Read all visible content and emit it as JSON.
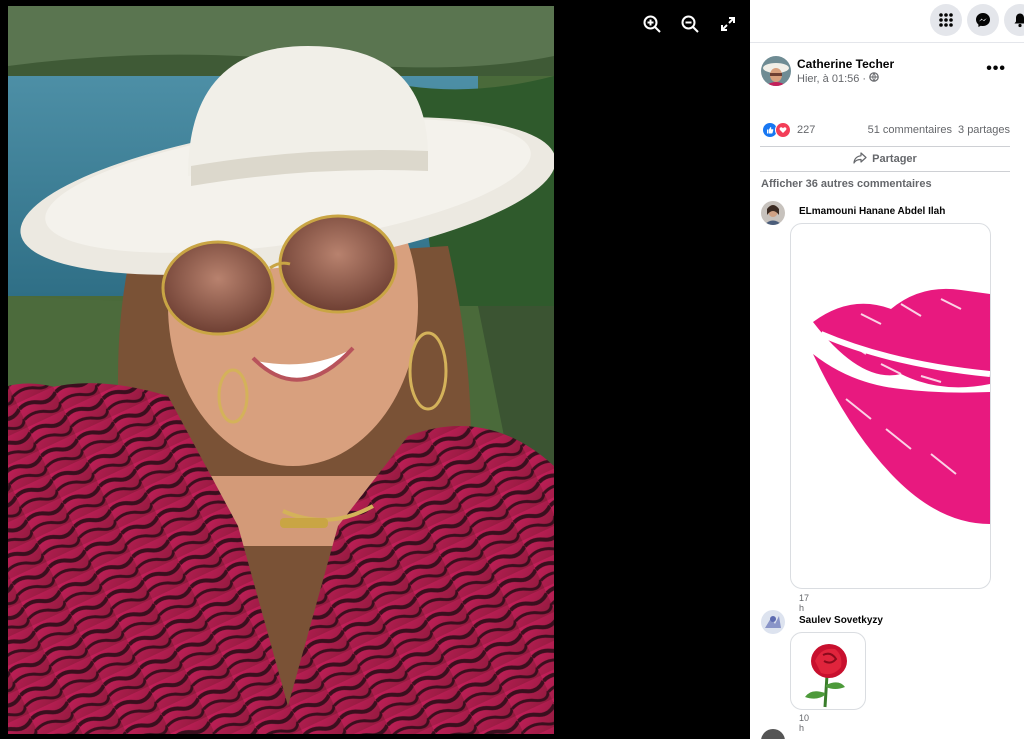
{
  "viewer": {
    "tools": [
      {
        "icon": "zoom-in-icon"
      },
      {
        "icon": "zoom-out-icon"
      },
      {
        "icon": "fullscreen-icon"
      }
    ]
  },
  "topbar": {
    "buttons": [
      {
        "icon": "menu-grid-icon"
      },
      {
        "icon": "messenger-icon"
      },
      {
        "icon": "notifications-bell-icon"
      }
    ]
  },
  "post": {
    "author": "Catherine Techer",
    "time": "Hier, à 01:56 ·",
    "privacy_icon": "globe-icon",
    "reaction_count": "227",
    "comment_count": "51 commentaires",
    "share_count": "3 partages",
    "share_label": "Partager"
  },
  "comments": {
    "more_label": "Afficher 36 autres commentaires",
    "items": [
      {
        "author": "ELmamouni Hanane Abdel Ilah",
        "time": "17 h",
        "media": "lipstick-kiss-sticker"
      },
      {
        "author": "Saulev Sovetkyzy",
        "time": "10 h",
        "media": "red-rose-sticker"
      }
    ]
  },
  "colors": {
    "like_blue": "#1877f2",
    "love_red": "#f33e58",
    "kiss_pink": "#e8197f",
    "rose_red": "#c8102e",
    "secondary_text": "#65676b"
  }
}
